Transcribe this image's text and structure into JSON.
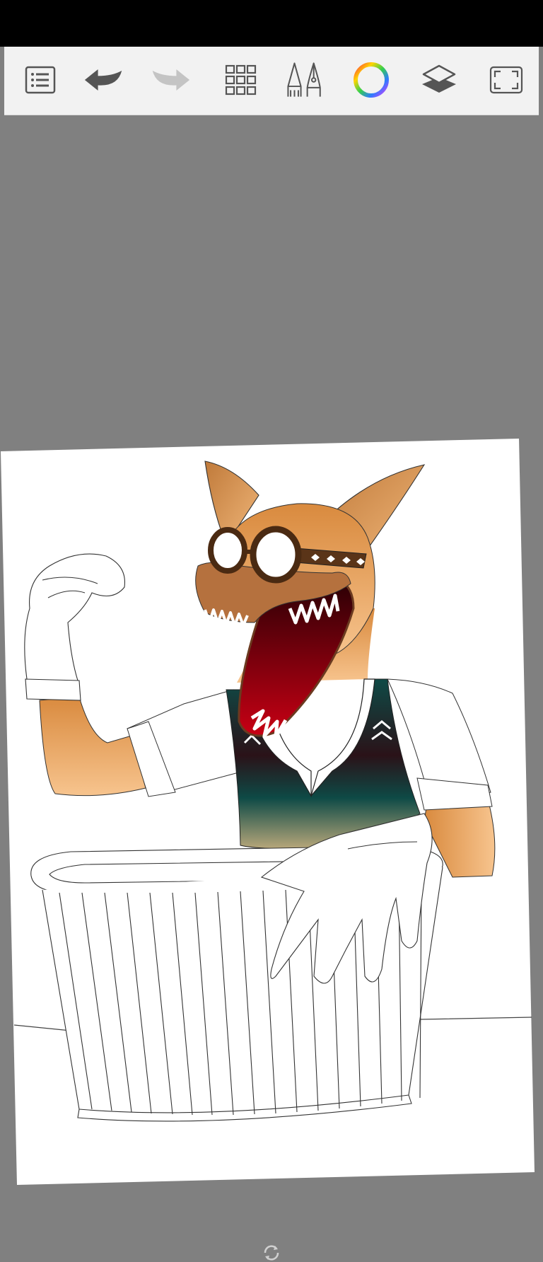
{
  "app": {
    "toolbar": {
      "tools": [
        {
          "name": "menu-list-icon",
          "enabled": true
        },
        {
          "name": "undo-icon",
          "enabled": true
        },
        {
          "name": "redo-icon",
          "enabled": false
        },
        {
          "name": "grid-icon",
          "enabled": true
        },
        {
          "name": "brush-pen-icon",
          "enabled": true
        },
        {
          "name": "color-wheel-icon",
          "enabled": true
        },
        {
          "name": "layers-icon",
          "enabled": true
        },
        {
          "name": "fullscreen-icon",
          "enabled": true
        }
      ]
    },
    "colors": {
      "status_bar": "#000000",
      "toolbar_bg": "#f2f2f2",
      "workspace_bg": "#808080",
      "canvas_bg": "#ffffff",
      "icon_dark": "#555555",
      "icon_disabled": "#c4c4c4",
      "fur": "#d98c3f",
      "vest": "#0e4a46",
      "mouth": "#8a0010"
    },
    "canvas": {
      "subject": "fox-creature-with-goggles-and-trash-can",
      "page_indicator_icon": "rotate-icon"
    }
  }
}
